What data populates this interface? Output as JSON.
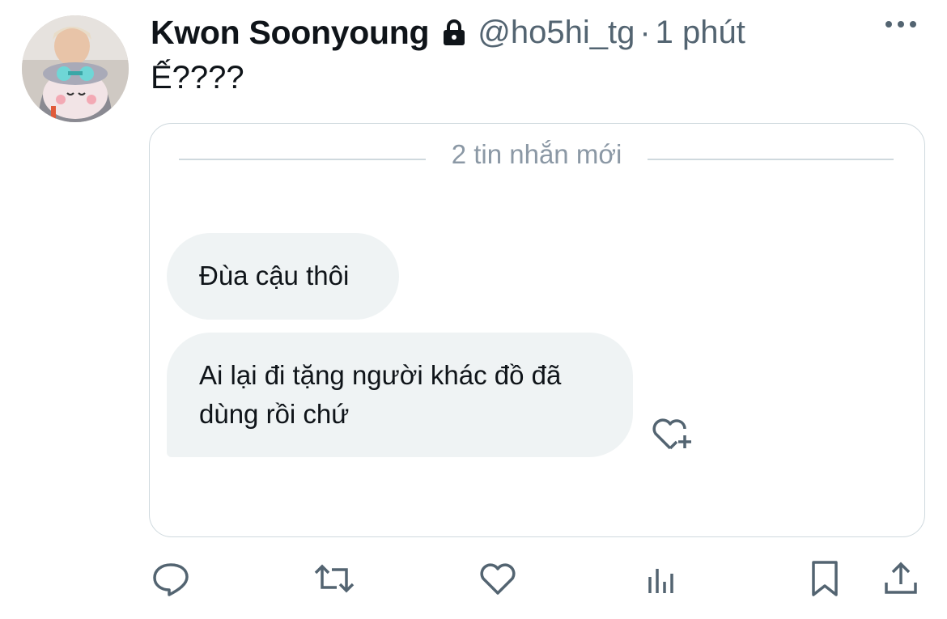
{
  "tweet": {
    "author_name": "Kwon Soonyoung",
    "handle": "@ho5hi_tg",
    "separator": "·",
    "timestamp": "1 phút",
    "text": "Ế????"
  },
  "media": {
    "divider_label": "2 tin nhắn mới",
    "messages": [
      {
        "text": "Đùa cậu thôi"
      },
      {
        "text_line1": "Ai lại đi tặng người khác đồ đã",
        "text_line2": "dùng rồi chứ"
      }
    ]
  },
  "icons": {
    "lock": "lock-icon",
    "more": "more-icon",
    "add_reaction": "heart-plus-icon",
    "reply": "reply-icon",
    "retweet": "retweet-icon",
    "like": "like-icon",
    "views": "views-icon",
    "bookmark": "bookmark-icon",
    "share": "share-icon"
  },
  "colors": {
    "text_primary": "#0f1419",
    "text_secondary": "#536471",
    "bubble_bg": "#eff3f4",
    "border": "#cfd9de"
  }
}
